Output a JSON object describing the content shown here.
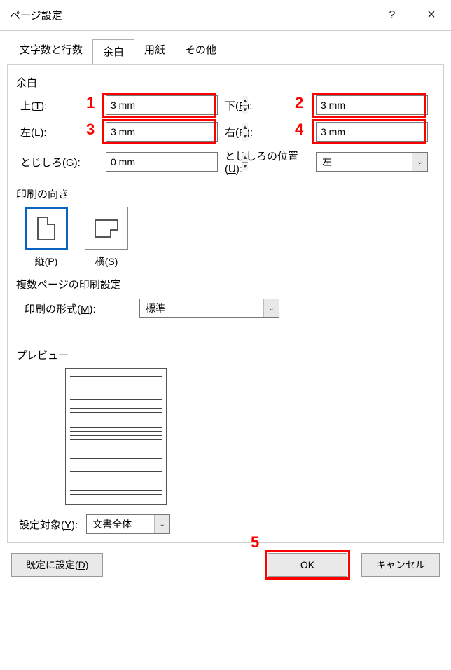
{
  "dialog": {
    "title": "ページ設定",
    "help_tooltip": "?",
    "close_tooltip": "×"
  },
  "tabs": {
    "chars_lines": "文字数と行数",
    "margins": "余白",
    "paper": "用紙",
    "other": "その他"
  },
  "margins": {
    "section": "余白",
    "top_label": "上(",
    "top_key": "T",
    "top_close": "):",
    "top_value": "3 mm",
    "bottom_label": "下(",
    "bottom_key": "B",
    "bottom_close": "):",
    "bottom_value": "3 mm",
    "left_label": "左(",
    "left_key": "L",
    "left_close": "):",
    "left_value": "3 mm",
    "right_label": "右(",
    "right_key": "R",
    "right_close": "):",
    "right_value": "3 mm",
    "gutter_label": "とじしろ(",
    "gutter_key": "G",
    "gutter_close": "):",
    "gutter_value": "0 mm",
    "gutter_pos_label": "とじしろの位置(",
    "gutter_pos_key": "U",
    "gutter_pos_close": "):",
    "gutter_pos_value": "左"
  },
  "orientation": {
    "section": "印刷の向き",
    "portrait_label": "縦(",
    "portrait_key": "P",
    "portrait_close": ")",
    "landscape_label": "横(",
    "landscape_key": "S",
    "landscape_close": ")"
  },
  "multipage": {
    "section": "複数ページの印刷設定",
    "format_label": "印刷の形式(",
    "format_key": "M",
    "format_close": "):",
    "format_value": "標準"
  },
  "preview": {
    "section": "プレビュー"
  },
  "apply_to": {
    "label": "設定対象(",
    "key": "Y",
    "close": "):",
    "value": "文書全体"
  },
  "buttons": {
    "set_default": "既定に設定(",
    "set_default_key": "D",
    "set_default_close": ")",
    "ok": "OK",
    "cancel": "キャンセル"
  },
  "callouts": {
    "c1": "1",
    "c2": "2",
    "c3": "3",
    "c4": "4",
    "c5": "5"
  }
}
